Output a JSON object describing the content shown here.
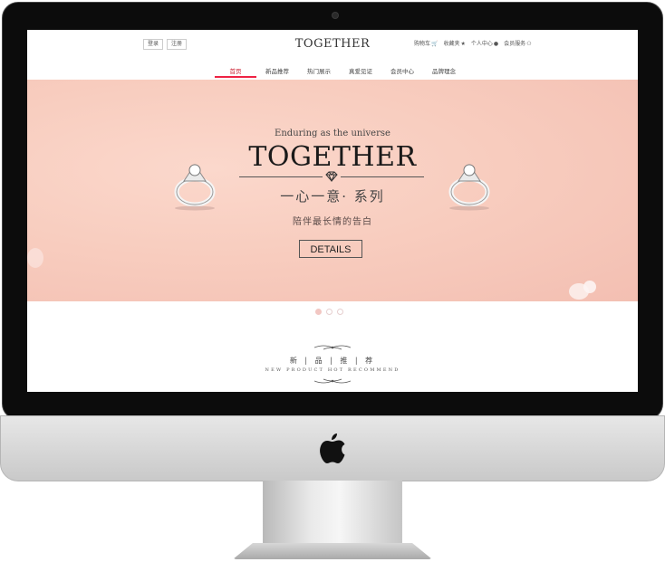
{
  "header": {
    "auth_links": [
      {
        "label": "登录"
      },
      {
        "label": "注册"
      }
    ],
    "logo": "TOGETHER",
    "tools": [
      {
        "label": "购物车",
        "icon": "cart-icon"
      },
      {
        "label": "收藏夹",
        "icon": "star-icon"
      },
      {
        "label": "个人中心",
        "icon": "user-icon"
      },
      {
        "label": "会员服务",
        "icon": "members-icon"
      }
    ]
  },
  "nav": {
    "items": [
      {
        "label": "首页",
        "active": true
      },
      {
        "label": "新品推荐",
        "active": false
      },
      {
        "label": "热门展示",
        "active": false
      },
      {
        "label": "真爱见证",
        "active": false
      },
      {
        "label": "会员中心",
        "active": false
      },
      {
        "label": "品牌理念",
        "active": false
      }
    ]
  },
  "banner": {
    "tagline": "Enduring as the universe",
    "title": "TOGETHER",
    "series": "一心一意· 系列",
    "slogan": "陪伴最长情的告白",
    "button_label": "DETAILS",
    "colors": {
      "background": "#f8cdbf",
      "accent": "#e22a44"
    },
    "carousel": {
      "count": 3,
      "active_index": 0
    }
  },
  "section": {
    "title_cn": "新 | 品 | 推 | 荐",
    "title_en": "NEW PRODUCT HOT RECOMMEND"
  }
}
